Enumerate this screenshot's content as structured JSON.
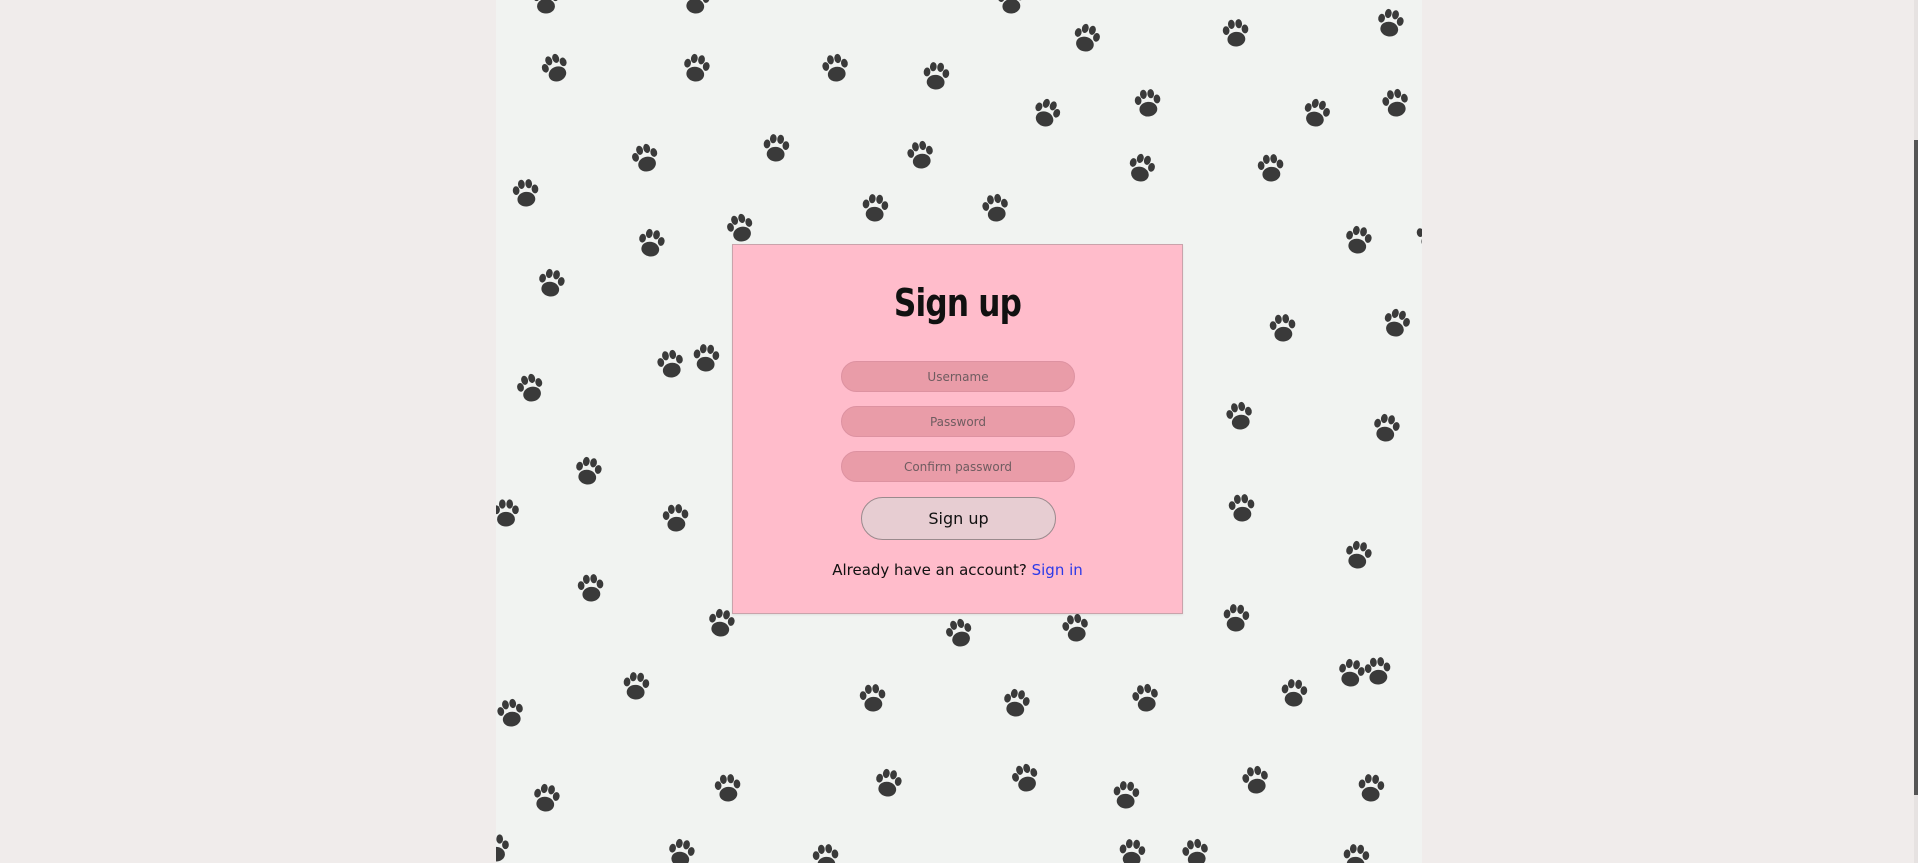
{
  "form": {
    "title": "Sign up",
    "username_placeholder": "Username",
    "password_placeholder": "Password",
    "confirm_placeholder": "Confirm password",
    "submit_label": "Sign up",
    "account_prompt": "Already have an account?",
    "signin_link_label": "Sign in"
  },
  "colors": {
    "page_background": "#f0eceb",
    "card_background": "#ffbccb",
    "input_background": "#e99ca8",
    "button_background": "#e7cdd2",
    "link_color": "#2c39e8",
    "paw_color": "#3a3a3a"
  },
  "background": {
    "pattern_icon": "paw-print-icon"
  }
}
